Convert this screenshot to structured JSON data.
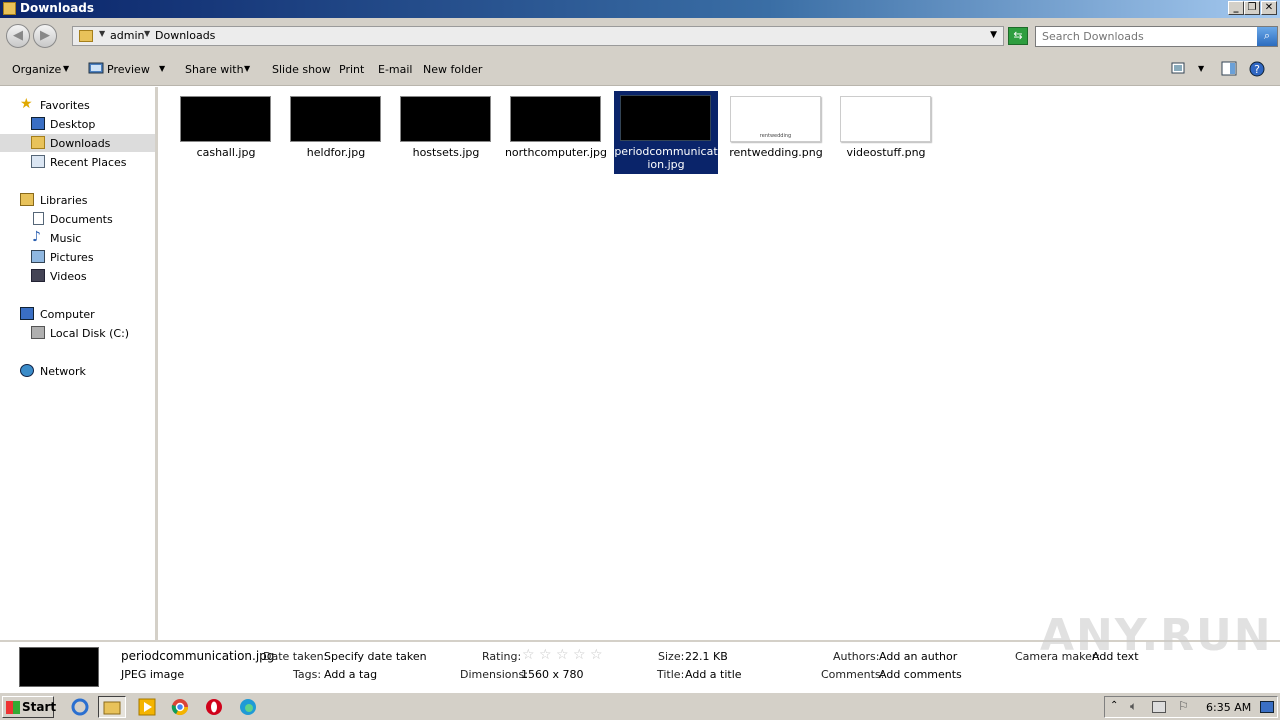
{
  "window": {
    "title": "Downloads"
  },
  "address": {
    "crumbs": [
      "admin",
      "Downloads"
    ],
    "search_placeholder": "Search Downloads"
  },
  "toolbar": {
    "organize": "Organize",
    "preview": "Preview",
    "share_with": "Share with",
    "slide_show": "Slide show",
    "print": "Print",
    "email": "E-mail",
    "new_folder": "New folder"
  },
  "nav": {
    "favorites": "Favorites",
    "desktop": "Desktop",
    "downloads": "Downloads",
    "recent_places": "Recent Places",
    "libraries": "Libraries",
    "documents": "Documents",
    "music": "Music",
    "pictures": "Pictures",
    "videos": "Videos",
    "computer": "Computer",
    "local_disk": "Local Disk (C:)",
    "network": "Network"
  },
  "files": [
    {
      "name": "cashall.jpg",
      "thumb": "dark"
    },
    {
      "name": "heldfor.jpg",
      "thumb": "dark"
    },
    {
      "name": "hostsets.jpg",
      "thumb": "dark"
    },
    {
      "name": "northcomputer.jpg",
      "thumb": "dark"
    },
    {
      "name": "periodcommunication.jpg",
      "thumb": "dark",
      "selected": true
    },
    {
      "name": "rentwedding.png",
      "thumb": "light",
      "thumb_text": "rentwedding"
    },
    {
      "name": "videostuff.png",
      "thumb": "light"
    }
  ],
  "details": {
    "filename": "periodcommunication.jpg",
    "filetype": "JPEG image",
    "date_taken_label": "Date taken:",
    "date_taken_value": "Specify date taken",
    "tags_label": "Tags:",
    "tags_value": "Add a tag",
    "rating_label": "Rating:",
    "rating_value": 0,
    "dimensions_label": "Dimensions:",
    "dimensions_value": "1560 x 780",
    "size_label": "Size:",
    "size_value": "22.1 KB",
    "title_label": "Title:",
    "title_value": "Add a title",
    "authors_label": "Authors:",
    "authors_value": "Add an author",
    "comments_label": "Comments:",
    "comments_value": "Add comments",
    "camera_label": "Camera maker:",
    "camera_value": "Add text"
  },
  "watermark": "ANY.RUN",
  "taskbar": {
    "start": "Start",
    "clock": "6:35 AM"
  }
}
